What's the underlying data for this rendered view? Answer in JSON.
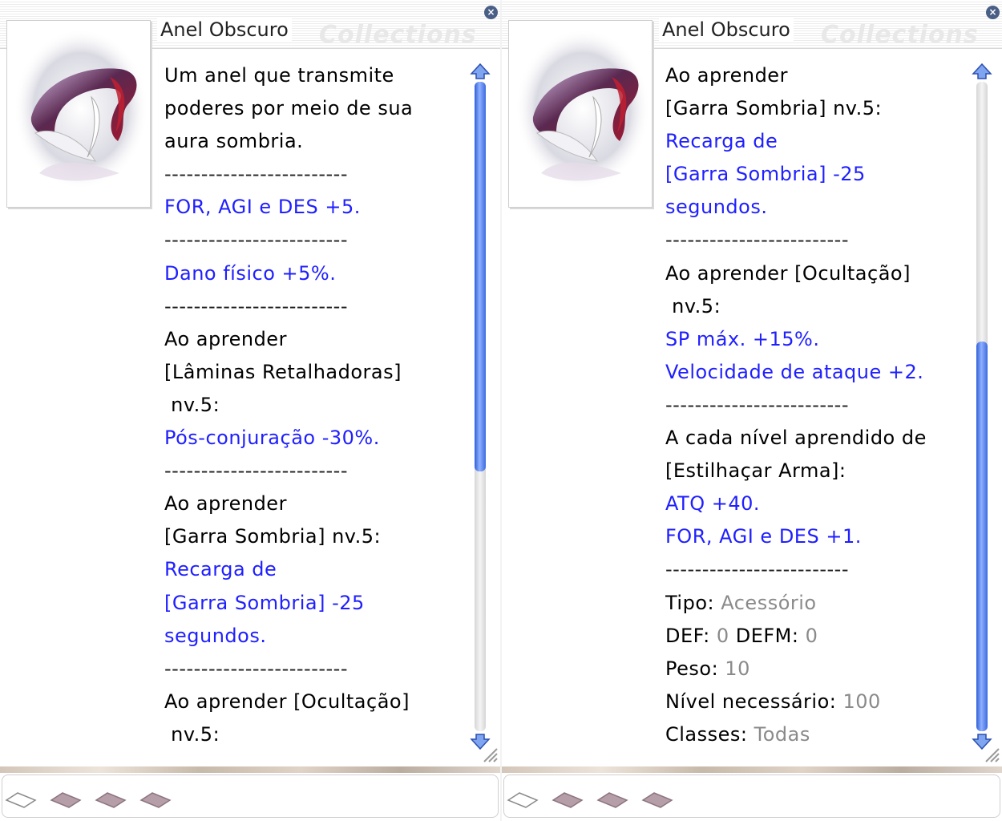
{
  "panels": [
    {
      "title": "Anel Obscuro",
      "watermark": "Collections",
      "image_icon": "dark-ring-item-icon",
      "description": [
        {
          "t": "Um anel que transmite",
          "c": "black"
        },
        {
          "t": "poderes por meio de sua",
          "c": "black"
        },
        {
          "t": "aura sombria.",
          "c": "black"
        },
        {
          "t": "-------------------------",
          "c": "dash"
        },
        {
          "t": "FOR, AGI e DES +5.",
          "c": "blue"
        },
        {
          "t": "-------------------------",
          "c": "dash"
        },
        {
          "t": "Dano físico +5%.",
          "c": "blue"
        },
        {
          "t": "-------------------------",
          "c": "dash"
        },
        {
          "t": "Ao aprender",
          "c": "black"
        },
        {
          "t": "[Lâminas Retalhadoras]",
          "c": "black"
        },
        {
          "t": " nv.5:",
          "c": "black"
        },
        {
          "t": "Pós-conjuração -30%.",
          "c": "blue"
        },
        {
          "t": "-------------------------",
          "c": "dash"
        },
        {
          "t": "Ao aprender",
          "c": "black"
        },
        {
          "t": "[Garra Sombria] nv.5:",
          "c": "black"
        },
        {
          "t": "Recarga de",
          "c": "blue"
        },
        {
          "t": "[Garra Sombria] -25",
          "c": "blue"
        },
        {
          "t": "segundos.",
          "c": "blue"
        },
        {
          "t": "-------------------------",
          "c": "dash"
        },
        {
          "t": "Ao aprender [Ocultação]",
          "c": "black"
        },
        {
          "t": " nv.5:",
          "c": "black"
        }
      ],
      "scroll": {
        "position": 0.0,
        "visible_fraction": 0.6
      }
    },
    {
      "title": "Anel Obscuro",
      "watermark": "Collections",
      "image_icon": "dark-ring-item-icon",
      "description": [
        {
          "t": "Ao aprender",
          "c": "black"
        },
        {
          "t": "[Garra Sombria] nv.5:",
          "c": "black"
        },
        {
          "t": "Recarga de",
          "c": "blue"
        },
        {
          "t": "[Garra Sombria] -25",
          "c": "blue"
        },
        {
          "t": "segundos.",
          "c": "blue"
        },
        {
          "t": "-------------------------",
          "c": "dash"
        },
        {
          "t": "Ao aprender [Ocultação]",
          "c": "black"
        },
        {
          "t": " nv.5:",
          "c": "black"
        },
        {
          "t": "SP máx. +15%.",
          "c": "blue"
        },
        {
          "t": "Velocidade de ataque +2.",
          "c": "blue"
        },
        {
          "t": "-------------------------",
          "c": "dash"
        },
        {
          "t": "A cada nível aprendido de",
          "c": "black"
        },
        {
          "t": "[Estilhaçar Arma]:",
          "c": "black"
        },
        {
          "t": "ATQ +40.",
          "c": "blue"
        },
        {
          "t": "FOR, AGI e DES +1.",
          "c": "blue"
        },
        {
          "t": "-------------------------",
          "c": "dash"
        }
      ],
      "stats": [
        {
          "label": "Tipo: ",
          "value": "Acessório"
        },
        {
          "label": "DEF: ",
          "value": "0",
          "label2": " DEFM: ",
          "value2": "0"
        },
        {
          "label": "Peso: ",
          "value": "10"
        },
        {
          "label": "Nível necessário: ",
          "value": "100"
        },
        {
          "label": "Classes: ",
          "value": "Todas"
        }
      ],
      "scroll": {
        "position": 1.0,
        "visible_fraction": 0.6
      }
    }
  ],
  "card_slots_icon": "card-slot-icon",
  "colors": {
    "blue_text": "#1f1fff",
    "gray_value": "#8a8a8a",
    "scroll_thumb": "#3c6ae0"
  }
}
